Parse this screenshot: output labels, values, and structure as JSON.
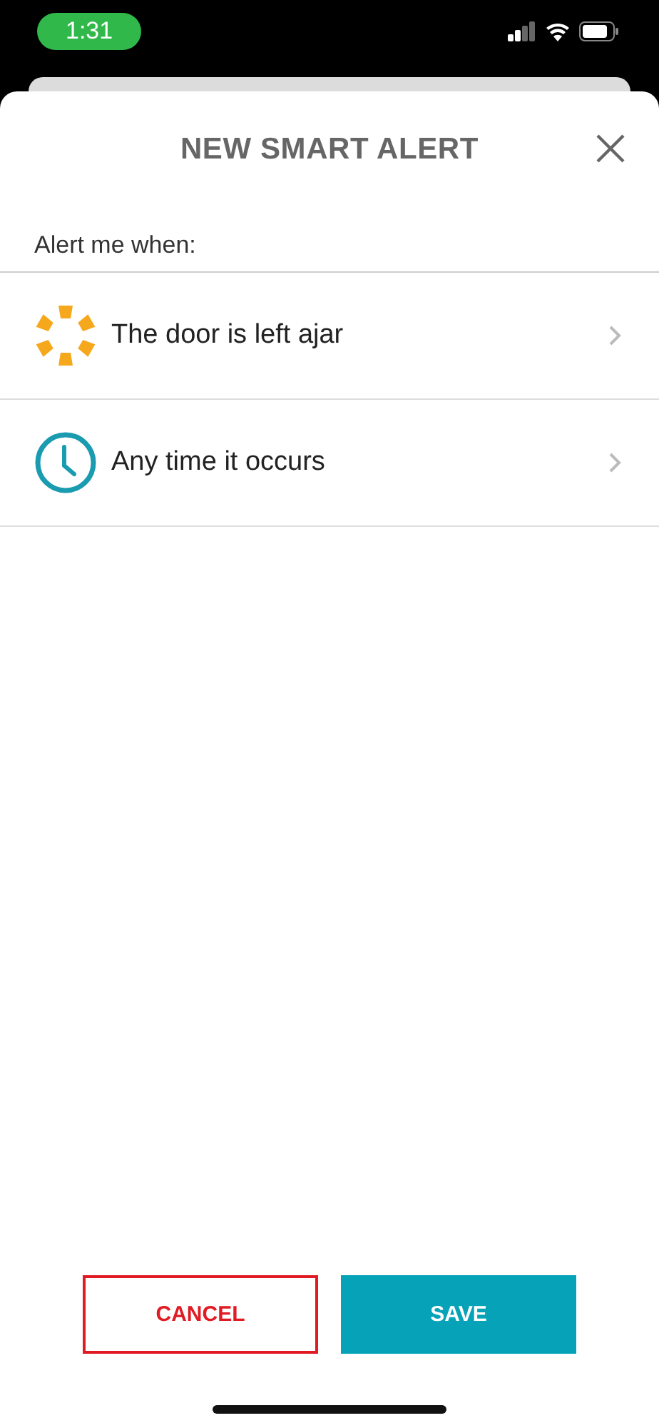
{
  "status_bar": {
    "time": "1:31"
  },
  "header": {
    "title": "NEW SMART ALERT"
  },
  "prompt": "Alert me when:",
  "conditions": [
    {
      "kind": "door",
      "label": "The door is left ajar"
    },
    {
      "kind": "clock",
      "label": "Any time it occurs"
    }
  ],
  "buttons": {
    "cancel": "CANCEL",
    "save": "SAVE"
  }
}
